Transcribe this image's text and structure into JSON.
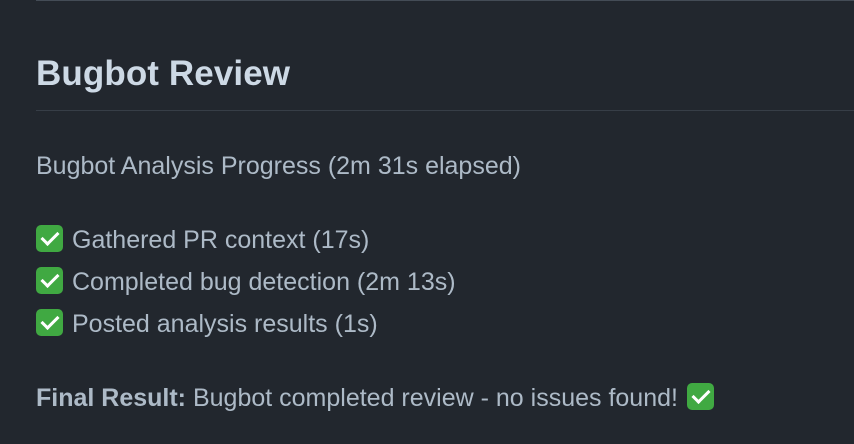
{
  "review": {
    "title": "Bugbot Review",
    "progress_text": "Bugbot Analysis Progress (2m 31s elapsed)",
    "steps": [
      {
        "icon": "check-mark-button-icon",
        "text": "Gathered PR context (17s)"
      },
      {
        "icon": "check-mark-button-icon",
        "text": "Completed bug detection (2m 13s)"
      },
      {
        "icon": "check-mark-button-icon",
        "text": "Posted analysis results (1s)"
      }
    ],
    "final_label": "Final Result:",
    "final_text": " Bugbot completed review - no issues found!",
    "final_icon": "check-mark-button-icon"
  },
  "colors": {
    "background": "#22272e",
    "text": "#adbac7",
    "heading": "#cdd9e5",
    "check_green": "#40a942"
  }
}
